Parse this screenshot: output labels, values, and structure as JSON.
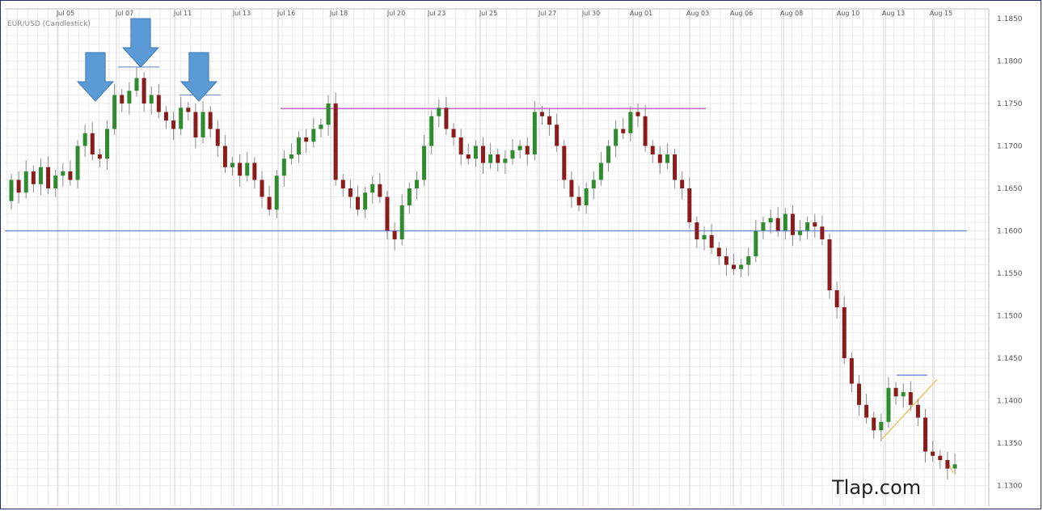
{
  "chart_data": {
    "type": "candlestick",
    "title": "EUR/USD (Candlestick)",
    "watermark": "Tlap.com",
    "x_tick_labels": [
      "Jul 05",
      "Jul 07",
      "Jul 11",
      "Jul 13",
      "Jul 16",
      "Jul 18",
      "Jul 20",
      "Jul 23",
      "Jul 25",
      "Jul 27",
      "Jul 30",
      "Aug 01",
      "Aug 03",
      "Aug 06",
      "Aug 08",
      "Aug 10",
      "Aug 13",
      "Aug 15"
    ],
    "y_ticks": [
      "1.1850",
      "1.1800",
      "1.1750",
      "1.1700",
      "1.1650",
      "1.1600",
      "1.1550",
      "1.1500",
      "1.1450",
      "1.1400",
      "1.1350",
      "1.1300"
    ],
    "ylim": [
      1.129,
      1.185
    ],
    "grid": true,
    "colors": {
      "up": "#2e8b2e",
      "down": "#8b1c1c",
      "grid": "#dcdcdc",
      "support": "#6f8fe0",
      "resistance": "#c070c8",
      "arrow": "#5b9bd5",
      "wedge": "#f0c060"
    },
    "price_path": [
      1.1635,
      1.166,
      1.1645,
      1.167,
      1.1655,
      1.1675,
      1.165,
      1.1665,
      1.167,
      1.166,
      1.17,
      1.1715,
      1.169,
      1.1685,
      1.172,
      1.176,
      1.175,
      1.1765,
      1.178,
      1.175,
      1.176,
      1.174,
      1.173,
      1.172,
      1.1745,
      1.174,
      1.171,
      1.174,
      1.172,
      1.17,
      1.1675,
      1.168,
      1.1665,
      1.168,
      1.166,
      1.164,
      1.1625,
      1.1665,
      1.1685,
      1.169,
      1.171,
      1.1705,
      1.172,
      1.1725,
      1.175,
      1.166,
      1.165,
      1.164,
      1.1625,
      1.1645,
      1.1655,
      1.164,
      1.16,
      1.159,
      1.163,
      1.165,
      1.166,
      1.17,
      1.1735,
      1.1745,
      1.172,
      1.171,
      1.169,
      1.1685,
      1.17,
      1.168,
      1.169,
      1.168,
      1.1685,
      1.1695,
      1.17,
      1.169,
      1.174,
      1.1735,
      1.1725,
      1.17,
      1.166,
      1.164,
      1.163,
      1.165,
      1.166,
      1.168,
      1.17,
      1.172,
      1.1715,
      1.174,
      1.1735,
      1.17,
      1.169,
      1.168,
      1.169,
      1.166,
      1.165,
      1.161,
      1.159,
      1.1595,
      1.158,
      1.157,
      1.156,
      1.1555,
      1.156,
      1.157,
      1.16,
      1.161,
      1.1615,
      1.16,
      1.162,
      1.1595,
      1.16,
      1.161,
      1.1605,
      1.159,
      1.153,
      1.151,
      1.145,
      1.142,
      1.1395,
      1.138,
      1.1365,
      1.1375,
      1.1415,
      1.1405,
      1.141,
      1.1395,
      1.138,
      1.134,
      1.1335,
      1.133,
      1.132,
      1.1325
    ]
  }
}
